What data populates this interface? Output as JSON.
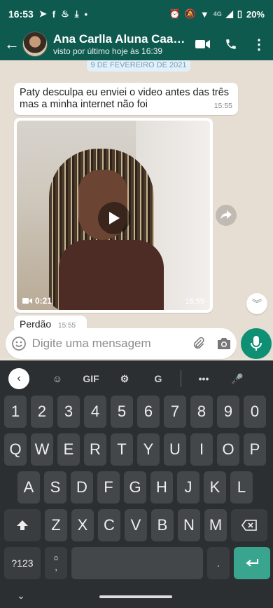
{
  "status_bar": {
    "time": "16:53",
    "battery": "20%",
    "network": "4G"
  },
  "header": {
    "contact_name": "Ana Carlla Aluna Caabe...",
    "last_seen": "visto por último hoje às 16:39"
  },
  "chat": {
    "date_chip": "9 DE FEVEREIRO DE 2021",
    "messages": [
      {
        "type": "text",
        "text": "Paty desculpa eu enviei o video antes das três mas a minha internet não foi",
        "time": "15:55"
      },
      {
        "type": "video",
        "duration": "0:21",
        "time": "15:55"
      },
      {
        "type": "text",
        "text": "Perdão",
        "time": "15:55"
      }
    ]
  },
  "composer": {
    "placeholder": "Digite uma mensagem"
  },
  "keyboard": {
    "toolbar": {
      "gif": "GIF"
    },
    "row_numbers": [
      "1",
      "2",
      "3",
      "4",
      "5",
      "6",
      "7",
      "8",
      "9",
      "0"
    ],
    "row1": [
      "Q",
      "W",
      "E",
      "R",
      "T",
      "Y",
      "U",
      "I",
      "O",
      "P"
    ],
    "row2": [
      "A",
      "S",
      "D",
      "F",
      "G",
      "H",
      "J",
      "K",
      "L"
    ],
    "row3": [
      "Z",
      "X",
      "C",
      "V",
      "B",
      "N",
      "M"
    ],
    "symbols_key": "?123",
    "comma_key": ",",
    "period_key": "."
  },
  "colors": {
    "header": "#0f5a4f",
    "accent": "#0f8f74",
    "keyboard_bg": "#2b2f31"
  }
}
